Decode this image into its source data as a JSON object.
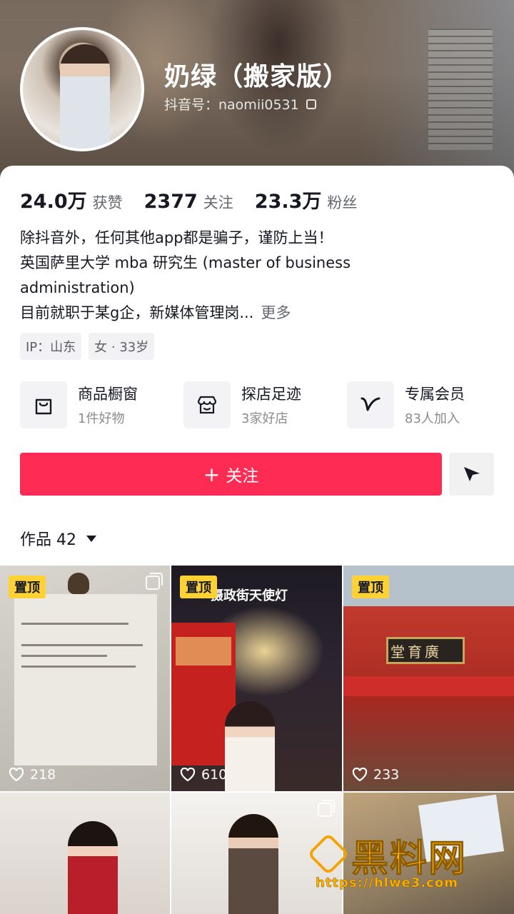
{
  "profile": {
    "nickname": "奶绿（搬家版）",
    "douyin_id": "抖音号：naomii0531"
  },
  "stats": [
    {
      "value": "24.0万",
      "label": "获赞"
    },
    {
      "value": "2377",
      "label": "关注"
    },
    {
      "value": "23.3万",
      "label": "粉丝"
    }
  ],
  "bio": {
    "line1": "除抖音外，任何其他app都是骗子，谨防上当！",
    "line2": "英国萨里大学 mba 研究生 (master of business",
    "line3": "administration)",
    "line4": "目前就职于某g企，新媒体管理岗...",
    "more": "更多"
  },
  "tags": [
    "IP：山东",
    "女 · 33岁"
  ],
  "services": [
    {
      "title": "商品橱窗",
      "sub": "1件好物",
      "icon": "bag-icon"
    },
    {
      "title": "探店足迹",
      "sub": "3家好店",
      "icon": "shop-icon"
    },
    {
      "title": "专属会员",
      "sub": "83人加入",
      "icon": "vip-icon"
    }
  ],
  "follow": {
    "label": "关注",
    "plus": "+"
  },
  "works": {
    "label": "作品 42"
  },
  "videos": [
    {
      "pinned": "置顶",
      "likes": "218",
      "overlay": ""
    },
    {
      "pinned": "置顶",
      "likes": "610",
      "overlay": "摄政街天使灯"
    },
    {
      "pinned": "置顶",
      "likes": "233",
      "overlay": "堂育廣"
    },
    {
      "pinned": "",
      "likes": "",
      "overlay": ""
    },
    {
      "pinned": "",
      "likes": "",
      "overlay": ""
    },
    {
      "pinned": "",
      "likes": "",
      "overlay": ""
    }
  ],
  "watermark": {
    "brand": "黑料网",
    "url": "https://hlwe3.com"
  },
  "colors": {
    "accent": "#fe2c55",
    "pin": "#fed234",
    "watermark": "#ffb400"
  }
}
